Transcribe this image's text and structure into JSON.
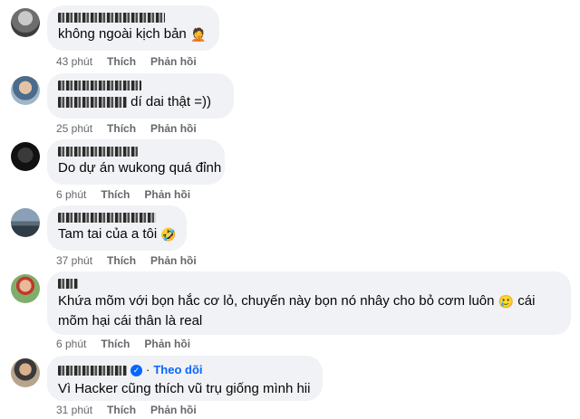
{
  "colors": {
    "bubble_bg": "#f0f2f5",
    "meta_text": "#65676b",
    "link_blue": "#0866ff"
  },
  "comments": [
    {
      "author": "Huy Thanh Trần",
      "text": "không ngoài kịch bản",
      "emoji": "🤦",
      "emoji_icon": "facepalm-emoji-icon",
      "time": "43 phút",
      "like": "Thích",
      "reply": "Phản hồi"
    },
    {
      "author": "Hưng Nghĩa",
      "text_pre": "Nguyễn Hưng",
      "text": "dí dai thật =))",
      "time": "25 phút",
      "like": "Thích",
      "reply": "Phản hồi"
    },
    {
      "author": "Phát Đức Anh",
      "text": "Do dự án wukong quá đỉnh",
      "time": "6 phút",
      "like": "Thích",
      "reply": "Phản hồi"
    },
    {
      "author": "Nguyễn Quốc Tuấn",
      "text": "Tam tai của a tôi",
      "emoji": "🤣",
      "emoji_icon": "rofl-emoji-icon",
      "time": "37 phút",
      "like": "Thích",
      "reply": "Phản hồi"
    },
    {
      "author": "Hà Mi",
      "text": "Khứa mõm với bọn hắc cơ lỏ, chuyến này bọn nó nhây cho bỏ cơm luôn",
      "emoji": "🥲",
      "emoji_icon": "smiling-tear-emoji-icon",
      "text_after": "cái mõm hại cái thân là real",
      "time": "6 phút",
      "like": "Thích",
      "reply": "Phản hồi"
    },
    {
      "author": "Hoàng Minh Hòa",
      "verified_icon": "verified-badge-icon",
      "follow": "Theo dõi",
      "text": "Vì Hacker cũng thích vũ trụ giống mình hii",
      "time": "31 phút",
      "like": "Thích",
      "reply": "Phản hồi"
    }
  ]
}
